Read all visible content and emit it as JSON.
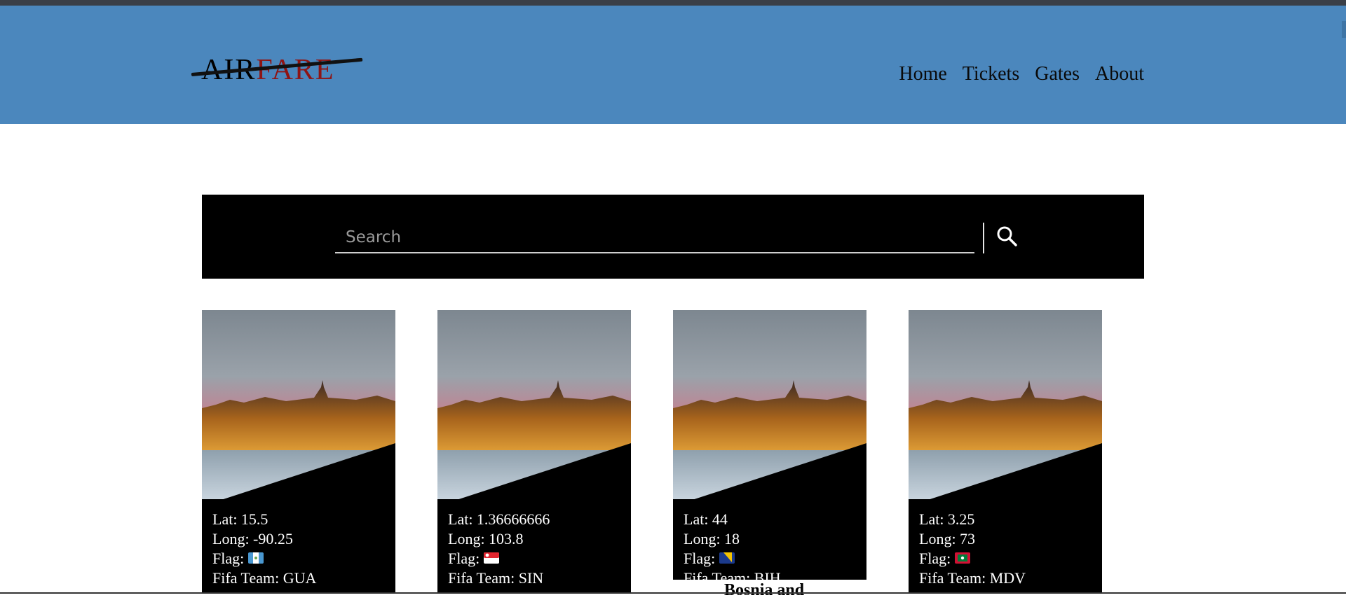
{
  "header": {
    "logo": {
      "part1": "AIR",
      "part2": "FARE"
    },
    "nav": [
      "Home",
      "Tickets",
      "Gates",
      "About"
    ]
  },
  "search": {
    "placeholder": "Search"
  },
  "cards": [
    {
      "lat": "Lat: 15.5",
      "long": "Long: -90.25",
      "flag_label": "Flag:",
      "flag": "guatemala-flag",
      "team": "Fifa Team: GUA"
    },
    {
      "lat": "Lat: 1.36666666",
      "long": "Long: 103.8",
      "flag_label": "Flag:",
      "flag": "singapore-flag",
      "team": "Fifa Team: SIN"
    },
    {
      "lat": "Lat: 44",
      "long": "Long: 18",
      "flag_label": "Flag:",
      "flag": "bosnia-flag",
      "team": "Fifa Team: BIH"
    },
    {
      "lat": "Lat: 3.25",
      "long": "Long: 73",
      "flag_label": "Flag:",
      "flag": "maldives-flag",
      "team": "Fifa Team: MDV"
    }
  ],
  "overflow_name": "Bosnia and",
  "colors": {
    "header_bg": "#4b87bd",
    "logo_red": "#8e1414",
    "card_bg": "#000000"
  }
}
